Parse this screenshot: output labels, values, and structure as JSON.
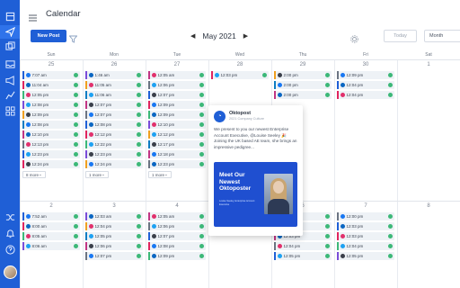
{
  "app": {
    "title": "Calendar"
  },
  "sidebar": {
    "icons": [
      "layout-icon",
      "send-icon",
      "copy-icon",
      "inbox-icon",
      "megaphone-icon",
      "chart-icon",
      "grid-icon",
      "shuffle-icon",
      "bell-icon",
      "help-icon"
    ]
  },
  "toolbar": {
    "new_post": "New Post",
    "month": "May 2021",
    "today": "Today",
    "view": "Month"
  },
  "days": [
    "Sun",
    "Mon",
    "Tue",
    "Wed",
    "Thu",
    "Fri",
    "Sat"
  ],
  "week1": {
    "dates": [
      "25",
      "26",
      "27",
      "28",
      "29",
      "30",
      "1"
    ],
    "cols": [
      [
        "7:07 am",
        "11:04 am",
        "12:05 pm",
        "12:08 pm",
        "12:09 pm",
        "12:08 pm",
        "12:10 pm",
        "12:13 pm",
        "12:23 pm",
        "12:24 pm"
      ],
      [
        "1:46 am",
        "11:05 am",
        "11:06 am",
        "12:07 pm",
        "12:07 pm",
        "12:08 pm",
        "12:12 pm",
        "12:22 pm",
        "12:23 pm",
        "12:24 pm"
      ],
      [
        "12:05 am",
        "12:06 pm",
        "12:07 pm",
        "12:09 pm",
        "12:09 pm",
        "12:10 pm",
        "12:12 pm",
        "12:17 pm",
        "12:18 pm",
        "12:23 pm"
      ],
      [
        "12:03 pm"
      ],
      [
        "2:00 pm",
        "2:00 pm",
        "2:00 pm"
      ],
      [
        "12:09 pm",
        "12:04 pm",
        "12:04 pm"
      ],
      []
    ],
    "more": [
      "8 more",
      "1 more",
      "1 more"
    ]
  },
  "week2": {
    "dates": [
      "2",
      "3",
      "4",
      "5",
      "6",
      "7",
      "8"
    ],
    "cols": [
      [
        "7:52 am",
        "8:00 am",
        "8:05 am",
        "8:06 am"
      ],
      [
        "12:03 am",
        "12:04 pm",
        "12:05 pm",
        "12:06 pm",
        "12:07 pm"
      ],
      [
        "12:05 am",
        "12:06 pm",
        "12:07 pm",
        "12:08 pm",
        "12:09 pm"
      ],
      [],
      [
        "12:01 pm",
        "12:03 pm",
        "12:03 pm",
        "12:04 pm",
        "12:05 pm"
      ],
      [
        "12:00 pm",
        "12:03 pm",
        "12:03 pm",
        "12:04 pm",
        "12:05 pm"
      ],
      []
    ]
  },
  "popup": {
    "account": "Oktopost",
    "subtitle": "2021 Company Culture",
    "text": "We present to you our newest Enterprise Account Executive, @Louise Seeley 🎉 Joining the UK based AE team, she brings an impressive pedigree...",
    "card_title": "Meet Our Newest Oktoposter",
    "card_meta": "Louise Seeley, Enterprise Account Executive"
  },
  "colors": {
    "accent": "#1f5fd6",
    "check": "#3cb878",
    "bars": [
      "#1f5fd6",
      "#e0245e",
      "#3cb878",
      "#7a4cd9",
      "#f0a020",
      "#0e7cc2",
      "#c13584",
      "#6b7482"
    ]
  }
}
